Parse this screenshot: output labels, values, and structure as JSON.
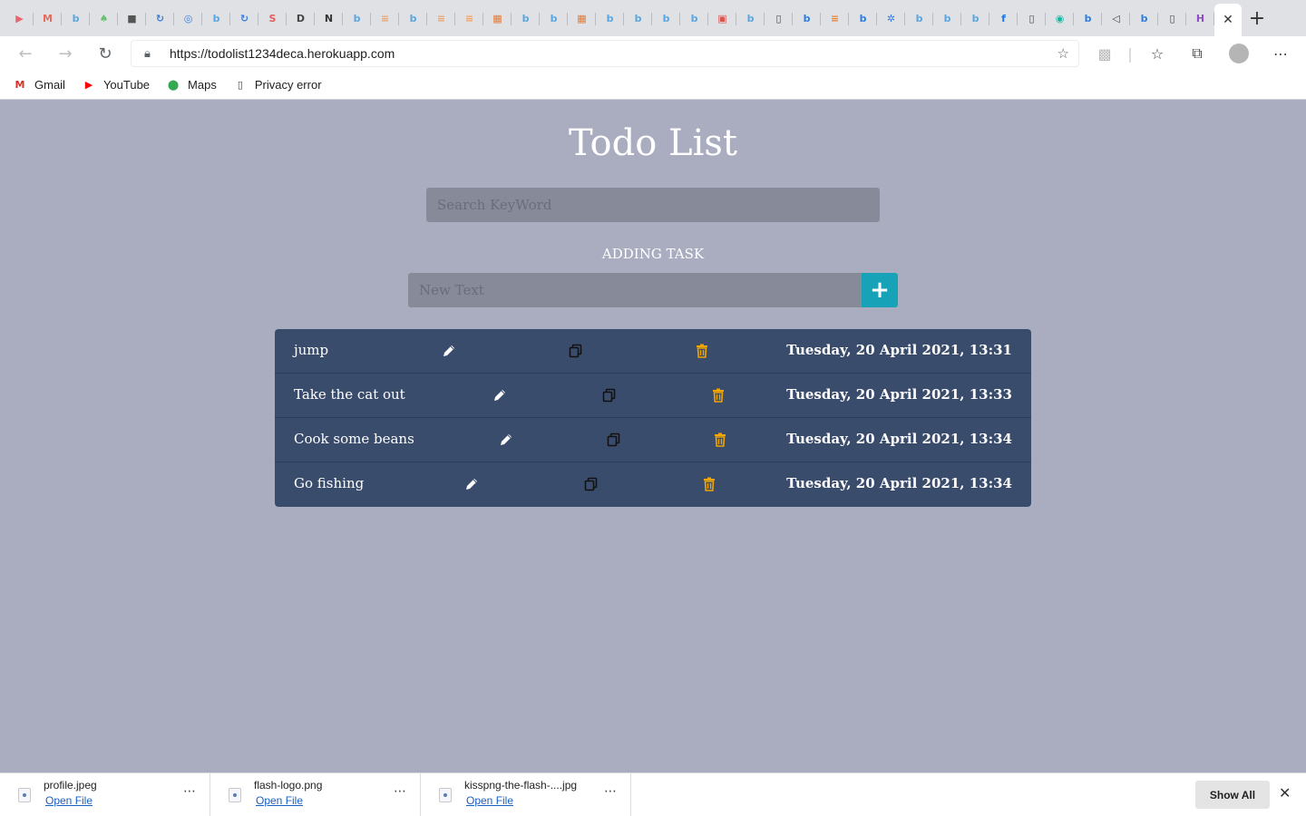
{
  "browser": {
    "tabs": [
      {
        "icon": "youtube-icon",
        "glyph": "▶",
        "color": "#e8666b"
      },
      {
        "icon": "gmail-icon",
        "glyph": "M",
        "color": "#e66a5c"
      },
      {
        "icon": "bing-icon",
        "glyph": "b",
        "color": "#5aa6e0"
      },
      {
        "icon": "leaf-icon",
        "glyph": "♠",
        "color": "#6fbf73"
      },
      {
        "icon": "meet-icon",
        "glyph": "■",
        "color": "#555555"
      },
      {
        "icon": "refresh-icon",
        "glyph": "↻",
        "color": "#3b7ddd"
      },
      {
        "icon": "circle-icon",
        "glyph": "◎",
        "color": "#3b7ddd"
      },
      {
        "icon": "bing-icon",
        "glyph": "b",
        "color": "#5aa6e0"
      },
      {
        "icon": "refresh-icon",
        "glyph": "↻",
        "color": "#3b7ddd"
      },
      {
        "icon": "slides-icon",
        "glyph": "S",
        "color": "#e0605a"
      },
      {
        "icon": "dev-icon",
        "glyph": "D",
        "color": "#444444"
      },
      {
        "icon": "notion-icon",
        "glyph": "N",
        "color": "#333333"
      },
      {
        "icon": "bing-icon",
        "glyph": "b",
        "color": "#5aa6e0"
      },
      {
        "icon": "stack-icon",
        "glyph": "≡",
        "color": "#f0a060"
      },
      {
        "icon": "bing-icon",
        "glyph": "b",
        "color": "#5aa6e0"
      },
      {
        "icon": "stack-icon",
        "glyph": "≡",
        "color": "#f0a060"
      },
      {
        "icon": "stack-icon",
        "glyph": "≡",
        "color": "#f0a060"
      },
      {
        "icon": "microsoft-icon",
        "glyph": "▦",
        "color": "#e07b39"
      },
      {
        "icon": "bing-icon",
        "glyph": "b",
        "color": "#5aa6e0"
      },
      {
        "icon": "bing-icon",
        "glyph": "b",
        "color": "#5aa6e0"
      },
      {
        "icon": "microsoft-icon",
        "glyph": "▦",
        "color": "#e07b39"
      },
      {
        "icon": "bing-icon",
        "glyph": "b",
        "color": "#5aa6e0"
      },
      {
        "icon": "bing-icon",
        "glyph": "b",
        "color": "#5aa6e0"
      },
      {
        "icon": "bing-icon",
        "glyph": "b",
        "color": "#5aa6e0"
      },
      {
        "icon": "bing-icon",
        "glyph": "b",
        "color": "#5aa6e0"
      },
      {
        "icon": "square-icon",
        "glyph": "▣",
        "color": "#d9534f"
      },
      {
        "icon": "bing-icon",
        "glyph": "b",
        "color": "#5aa6e0"
      },
      {
        "icon": "page-icon",
        "glyph": "▯",
        "color": "#444444"
      },
      {
        "icon": "bing-icon",
        "glyph": "b",
        "color": "#2a7de1"
      },
      {
        "icon": "stack-icon",
        "glyph": "≡",
        "color": "#f07f2a"
      },
      {
        "icon": "bing-icon",
        "glyph": "b",
        "color": "#2a7de1"
      },
      {
        "icon": "gear-icon",
        "glyph": "✲",
        "color": "#3b7ddd"
      },
      {
        "icon": "bing-icon",
        "glyph": "b",
        "color": "#5aa6e0"
      },
      {
        "icon": "bing-icon",
        "glyph": "b",
        "color": "#5aa6e0"
      },
      {
        "icon": "bing-icon",
        "glyph": "b",
        "color": "#5aa6e0"
      },
      {
        "icon": "facebook-icon",
        "glyph": "f",
        "color": "#1877f2"
      },
      {
        "icon": "page-icon",
        "glyph": "▯",
        "color": "#444444"
      },
      {
        "icon": "eye-icon",
        "glyph": "◉",
        "color": "#1fb5a3"
      },
      {
        "icon": "bing-icon",
        "glyph": "b",
        "color": "#2a7de1"
      },
      {
        "icon": "speaker-icon",
        "glyph": "◁",
        "color": "#444444"
      },
      {
        "icon": "bing-icon",
        "glyph": "b",
        "color": "#2a7de1"
      },
      {
        "icon": "page-icon",
        "glyph": "▯",
        "color": "#444444"
      },
      {
        "icon": "h-icon",
        "glyph": "H",
        "color": "#8e4ec6"
      }
    ],
    "url": "https://todolist1234deca.herokuapp.com",
    "bookmarks": [
      {
        "label": "Gmail",
        "icon": "gmail-icon",
        "glyph": "M",
        "color": "#d93025"
      },
      {
        "label": "YouTube",
        "icon": "youtube-icon",
        "glyph": "▶",
        "color": "#ff0000"
      },
      {
        "label": "Maps",
        "icon": "maps-pin-icon",
        "glyph": "⬤",
        "color": "#34a853"
      },
      {
        "label": "Privacy error",
        "icon": "page-icon",
        "glyph": "▯",
        "color": "#444444"
      }
    ]
  },
  "app": {
    "title": "Todo List",
    "search_placeholder": "Search KeyWord",
    "adding_label": "ADDING TASK",
    "new_text_placeholder": "New Text",
    "add_button": "+",
    "accent_color": "#17a2b8",
    "delete_color": "#f0a500"
  },
  "todos": [
    {
      "task": "jump",
      "date": "Tuesday, 20 April 2021, 13:31"
    },
    {
      "task": "Take the cat out",
      "date": "Tuesday, 20 April 2021, 13:33"
    },
    {
      "task": "Cook some beans",
      "date": "Tuesday, 20 April 2021, 13:34"
    },
    {
      "task": "Go fishing",
      "date": "Tuesday, 20 April 2021, 13:34"
    }
  ],
  "downloads": {
    "items": [
      {
        "name": "profile.jpeg",
        "action": "Open File"
      },
      {
        "name": "flash-logo.png",
        "action": "Open File"
      },
      {
        "name": "kisspng-the-flash-....jpg",
        "action": "Open File"
      }
    ],
    "show_all": "Show All"
  }
}
